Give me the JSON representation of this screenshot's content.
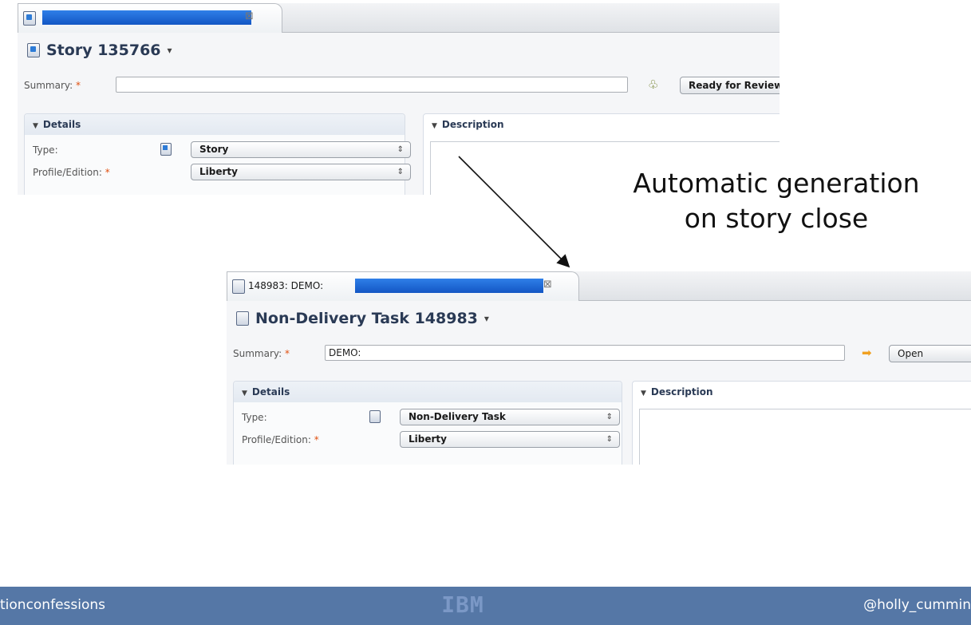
{
  "top_window": {
    "tab": {
      "label": "",
      "close_glyph": "⊠"
    },
    "header": {
      "title": "Story 135766",
      "menu_glyph": "▾"
    },
    "summary": {
      "label": "Summary:",
      "required_marker": "*",
      "value": ""
    },
    "state_button": "Ready for Review",
    "details": {
      "heading": "Details",
      "rows": [
        {
          "label": "Type:",
          "required": false,
          "value": "Story",
          "icon": "story-icon"
        },
        {
          "label": "Profile/Edition:",
          "required": true,
          "value": "Liberty",
          "icon": ""
        }
      ]
    },
    "description": {
      "heading": "Description"
    }
  },
  "bottom_window": {
    "tab": {
      "label": "148983: DEMO:",
      "close_glyph": "⊠"
    },
    "header": {
      "title": "Non-Delivery Task 148983",
      "menu_glyph": "▾"
    },
    "summary": {
      "label": "Summary:",
      "required_marker": "*",
      "value": "DEMO:"
    },
    "state_button": "Open",
    "details": {
      "heading": "Details",
      "rows": [
        {
          "label": "Type:",
          "required": false,
          "value": "Non-Delivery Task",
          "icon": "task-icon"
        },
        {
          "label": "Profile/Edition:",
          "required": true,
          "value": "Liberty",
          "icon": ""
        }
      ]
    },
    "description": {
      "heading": "Description"
    }
  },
  "annotation": {
    "line1": "Automatic generation",
    "line2": "on story close"
  },
  "footer": {
    "left": "tionconfessions",
    "center_logo": "IBM",
    "right": "@holly_cummin"
  },
  "colors": {
    "footer_bg": "#5577a6",
    "selection_blue": "#1e6ad8",
    "required_marker": "#e05010"
  }
}
